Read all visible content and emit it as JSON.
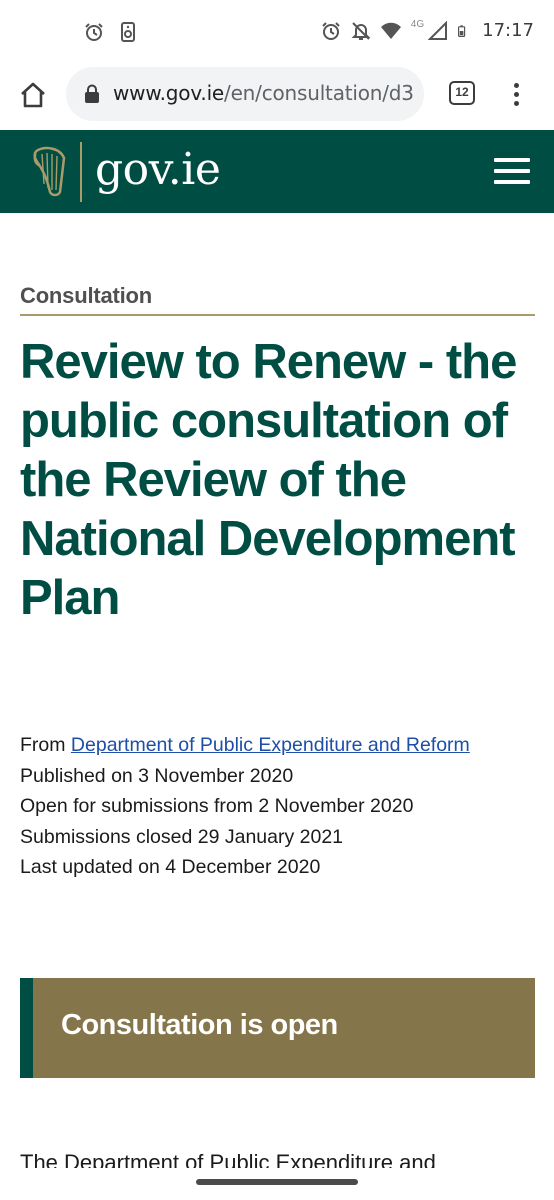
{
  "status_bar": {
    "time": "17:17",
    "network_type": "4G",
    "left_icons": [
      "alarm-icon",
      "speaker-icon"
    ],
    "right_icons": [
      "alarm-icon",
      "bell-off-icon",
      "wifi-icon",
      "signal-icon",
      "battery-icon"
    ]
  },
  "browser": {
    "url_domain": "www.gov.ie",
    "url_path": "/en/consultation/d3",
    "tab_count": "12"
  },
  "site": {
    "logo_text": "gov.ie"
  },
  "page": {
    "eyebrow": "Consultation",
    "title": "Review to Renew - the public consultation of the Review of the National Development Plan",
    "from_label": "From",
    "from_link": "Department of Public Expenditure and Reform",
    "published": "Published on 3 November 2020",
    "open_for": "Open for submissions from 2 November 2020",
    "closed": "Submissions closed 29 January 2021",
    "last_updated": "Last updated on 4 December 2020",
    "callout": "Consultation is open",
    "body_start": "The Department of Public Expenditure and"
  },
  "colors": {
    "brand_green": "#004d44",
    "callout_gold": "#85754a",
    "link_blue": "#1d4fa8"
  }
}
